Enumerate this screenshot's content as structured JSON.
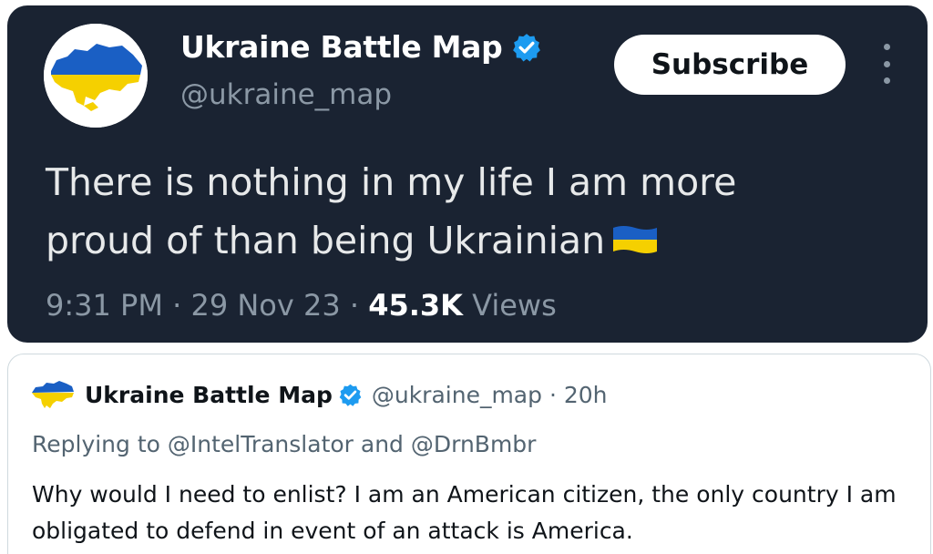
{
  "main_tweet": {
    "display_name": "Ukraine Battle Map",
    "handle": "@ukraine_map",
    "subscribe_label": "Subscribe",
    "text_line1": "There is nothing in my life I am more",
    "text_line2": "proud of than being Ukrainian",
    "time": "9:31 PM",
    "date": "29 Nov 23",
    "views_count": "45.3K",
    "views_label": "Views",
    "separator": "·"
  },
  "quoted_reply": {
    "display_name": "Ukraine Battle Map",
    "handle_time": "@ukraine_map · 20h",
    "replying_to": "Replying to @IntelTranslator and @DrnBmbr",
    "text": "Why would I need to enlist? I am an American citizen, the only country I am obligated to defend in event of an attack is America."
  },
  "icons": {
    "avatar": "ukraine-map-avatar",
    "verified": "verified-badge-icon",
    "more": "more-options-icon",
    "flag": "ukraine-flag-icon"
  },
  "colors": {
    "dark_bg": "#1a2332",
    "verified_blue": "#1d9bf0",
    "flag_blue": "#1a5fc4",
    "flag_yellow": "#f5d000",
    "muted_text_dark": "#8b98a5",
    "muted_text_light": "#536471"
  }
}
